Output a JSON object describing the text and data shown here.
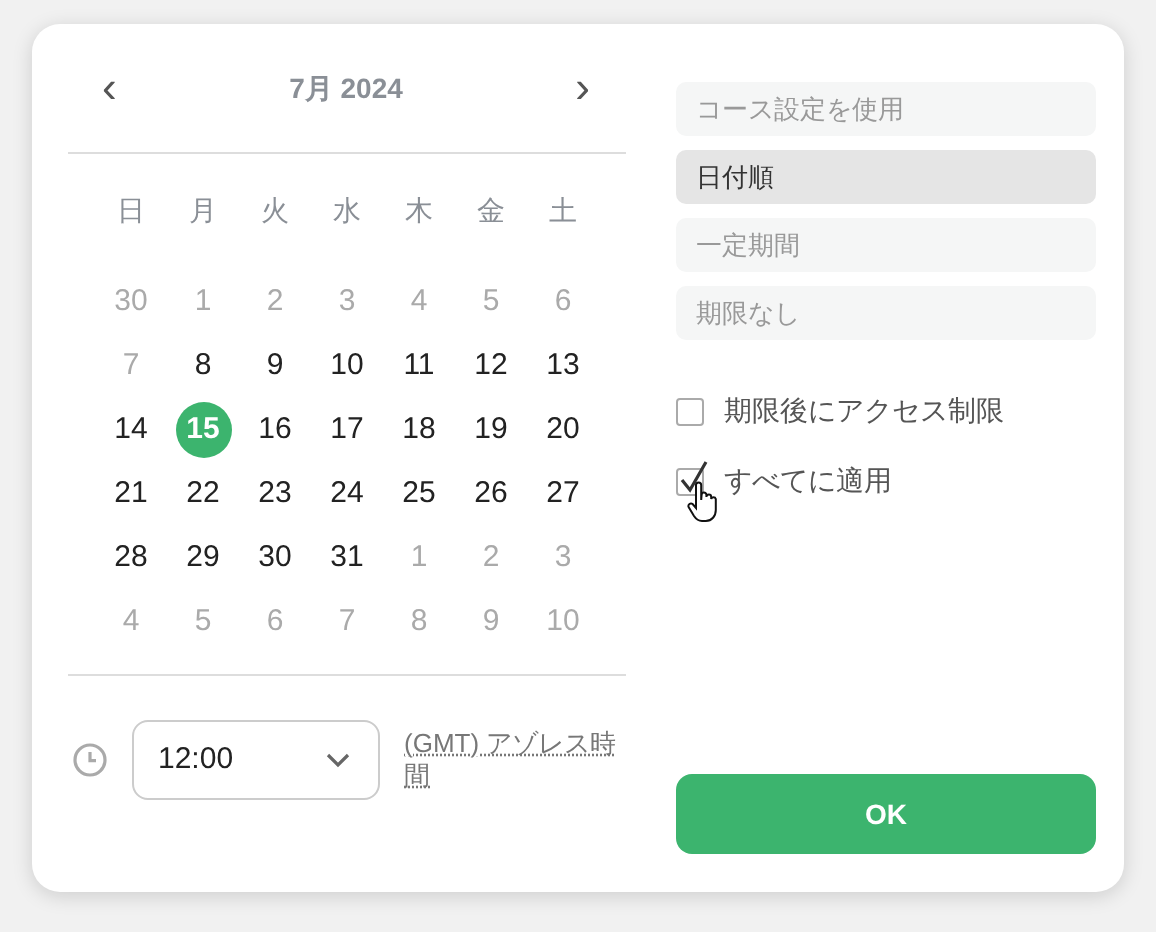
{
  "calendar": {
    "prev": "‹",
    "title": "7月 2024",
    "next": "›",
    "weekdays": [
      "日",
      "月",
      "火",
      "水",
      "木",
      "金",
      "土"
    ],
    "weeks": [
      [
        {
          "day": "30",
          "muted": true,
          "selected": false
        },
        {
          "day": "1",
          "muted": true,
          "selected": false
        },
        {
          "day": "2",
          "muted": true,
          "selected": false
        },
        {
          "day": "3",
          "muted": true,
          "selected": false
        },
        {
          "day": "4",
          "muted": true,
          "selected": false
        },
        {
          "day": "5",
          "muted": true,
          "selected": false
        },
        {
          "day": "6",
          "muted": true,
          "selected": false
        }
      ],
      [
        {
          "day": "7",
          "muted": true,
          "selected": false
        },
        {
          "day": "8",
          "muted": false,
          "selected": false
        },
        {
          "day": "9",
          "muted": false,
          "selected": false
        },
        {
          "day": "10",
          "muted": false,
          "selected": false
        },
        {
          "day": "11",
          "muted": false,
          "selected": false
        },
        {
          "day": "12",
          "muted": false,
          "selected": false
        },
        {
          "day": "13",
          "muted": false,
          "selected": false
        }
      ],
      [
        {
          "day": "14",
          "muted": false,
          "selected": false
        },
        {
          "day": "15",
          "muted": false,
          "selected": true
        },
        {
          "day": "16",
          "muted": false,
          "selected": false
        },
        {
          "day": "17",
          "muted": false,
          "selected": false
        },
        {
          "day": "18",
          "muted": false,
          "selected": false
        },
        {
          "day": "19",
          "muted": false,
          "selected": false
        },
        {
          "day": "20",
          "muted": false,
          "selected": false
        }
      ],
      [
        {
          "day": "21",
          "muted": false,
          "selected": false
        },
        {
          "day": "22",
          "muted": false,
          "selected": false
        },
        {
          "day": "23",
          "muted": false,
          "selected": false
        },
        {
          "day": "24",
          "muted": false,
          "selected": false
        },
        {
          "day": "25",
          "muted": false,
          "selected": false
        },
        {
          "day": "26",
          "muted": false,
          "selected": false
        },
        {
          "day": "27",
          "muted": false,
          "selected": false
        }
      ],
      [
        {
          "day": "28",
          "muted": false,
          "selected": false
        },
        {
          "day": "29",
          "muted": false,
          "selected": false
        },
        {
          "day": "30",
          "muted": false,
          "selected": false
        },
        {
          "day": "31",
          "muted": false,
          "selected": false
        },
        {
          "day": "1",
          "muted": true,
          "selected": false
        },
        {
          "day": "2",
          "muted": true,
          "selected": false
        },
        {
          "day": "3",
          "muted": true,
          "selected": false
        }
      ],
      [
        {
          "day": "4",
          "muted": true,
          "selected": false
        },
        {
          "day": "5",
          "muted": true,
          "selected": false
        },
        {
          "day": "6",
          "muted": true,
          "selected": false
        },
        {
          "day": "7",
          "muted": true,
          "selected": false
        },
        {
          "day": "8",
          "muted": true,
          "selected": false
        },
        {
          "day": "9",
          "muted": true,
          "selected": false
        },
        {
          "day": "10",
          "muted": true,
          "selected": false
        }
      ]
    ]
  },
  "time": {
    "value": "12:00",
    "timezone": "(GMT) アゾレス時間"
  },
  "options": [
    {
      "label": "コース設定を使用",
      "selected": false
    },
    {
      "label": "日付順",
      "selected": true
    },
    {
      "label": "一定期間",
      "selected": false
    },
    {
      "label": "期限なし",
      "selected": false
    }
  ],
  "checkboxes": [
    {
      "label": "期限後にアクセス制限",
      "checked": false
    },
    {
      "label": "すべてに適用",
      "checked": true
    }
  ],
  "ok_button": "OK"
}
